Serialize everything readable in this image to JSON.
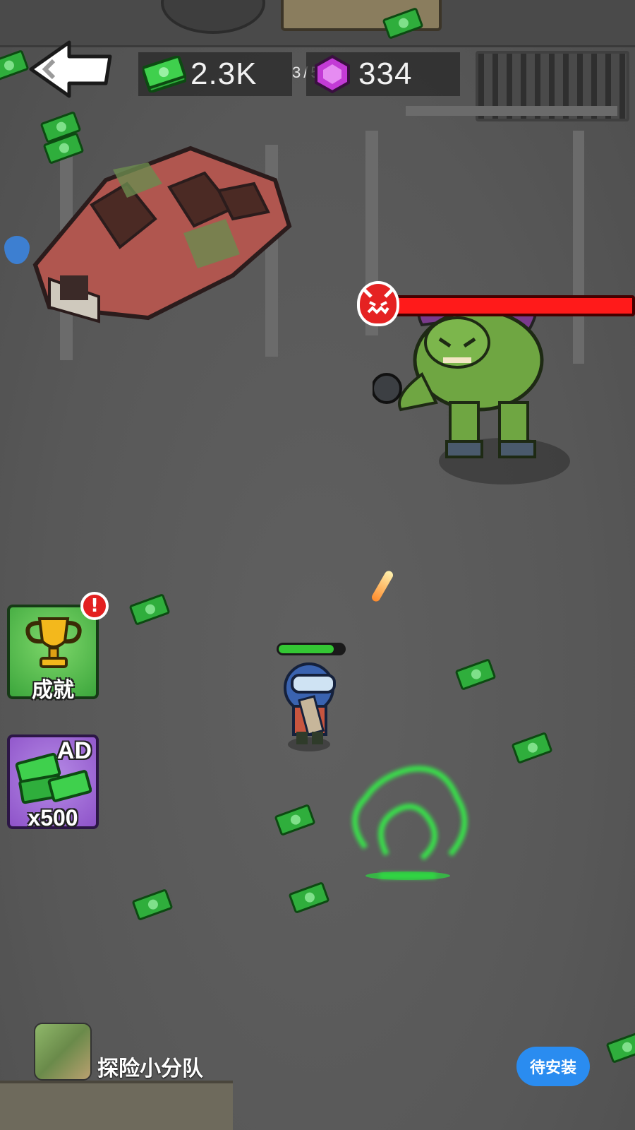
{
  "hud": {
    "cash_value": "2.3K",
    "wave_current": "3",
    "wave_separator": "/",
    "wave_total": "5",
    "gems_value": "334"
  },
  "boss": {
    "health_fraction": 1.0
  },
  "player": {
    "health_fraction": 0.85
  },
  "side_buttons": {
    "achievements_label": "成就",
    "ad_badge": "AD",
    "ad_reward_label": "x500"
  },
  "ad_banner": {
    "app_name": "探险小分队",
    "install_button_label": "待安装"
  },
  "icons": {
    "back": "back-arrow-icon",
    "cash": "cash-icon",
    "gem": "gem-icon",
    "boss": "boss-skull-icon",
    "trophy": "trophy-icon",
    "alert": "alert-badge-icon",
    "shield": "shield-lock-icon"
  },
  "colors": {
    "cash_green": "#2fae3c",
    "gem_purple": "#c33bd6",
    "boss_health_red": "#e01010",
    "player_health_green": "#34c734",
    "install_blue": "#2a8cf0",
    "achievement_button_green": "#3ca63c",
    "ad_button_purple": "#8e53c9"
  }
}
